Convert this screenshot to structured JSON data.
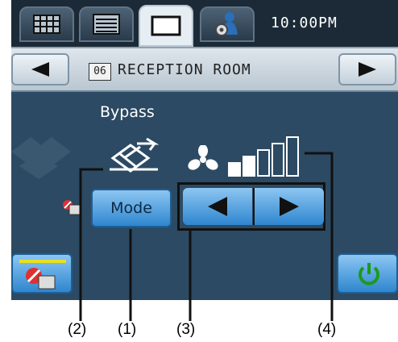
{
  "tabs": [
    {
      "name": "grid-view-icon"
    },
    {
      "name": "list-view-icon"
    },
    {
      "name": "single-view-icon"
    },
    {
      "name": "settings-user-icon"
    }
  ],
  "clock": "10:00PM",
  "room": {
    "number": "06",
    "name": "RECEPTION ROOM"
  },
  "mode": {
    "label": "Bypass"
  },
  "buttons": {
    "mode": "Mode"
  },
  "fan": {
    "level": 2,
    "max_level": 5
  },
  "callouts": [
    "(2)",
    "(1)",
    "(3)",
    "(4)"
  ]
}
